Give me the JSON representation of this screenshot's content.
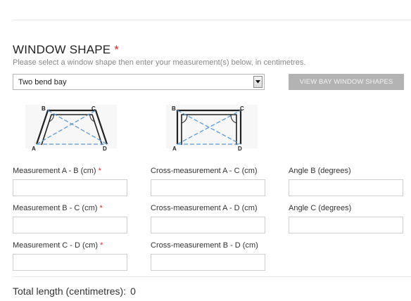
{
  "header": {
    "title": "WINDOW SHAPE",
    "required_marker": "*",
    "subtitle": "Please select a window shape then enter your measurement(s) below, in centimetres."
  },
  "shape_select": {
    "selected": "Two bend bay",
    "arrow_icon": "dropdown-arrow-icon"
  },
  "view_button": {
    "label": "VIEW BAY WINDOW SHAPES"
  },
  "diagrams": [
    {
      "name": "splayed-bay",
      "corners": [
        "A",
        "B",
        "C",
        "D"
      ]
    },
    {
      "name": "square-bay",
      "corners": [
        "A",
        "B",
        "C",
        "D"
      ]
    }
  ],
  "fields": {
    "ab": {
      "label": "Measurement A - B (cm)",
      "required": "*",
      "value": ""
    },
    "bc": {
      "label": "Measurement B - C (cm)",
      "required": "*",
      "value": ""
    },
    "cd": {
      "label": "Measurement C - D (cm)",
      "required": "*",
      "value": ""
    },
    "ac": {
      "label": "Cross-measurement A - C (cm)",
      "value": ""
    },
    "ad": {
      "label": "Cross-measurement A - D (cm)",
      "value": ""
    },
    "bd": {
      "label": "Cross-measurement B - D (cm)",
      "value": ""
    },
    "angleB": {
      "label": "Angle B (degrees)",
      "value": ""
    },
    "angleC": {
      "label": "Angle C (degrees)",
      "value": ""
    }
  },
  "total": {
    "label": "Total length (centimetres):",
    "value": "0"
  },
  "colors": {
    "accent_required": "#d9282f",
    "button_bg": "#b3b3b3",
    "diagram_frame": "#222222",
    "diagram_dash": "#5b9bd5"
  }
}
